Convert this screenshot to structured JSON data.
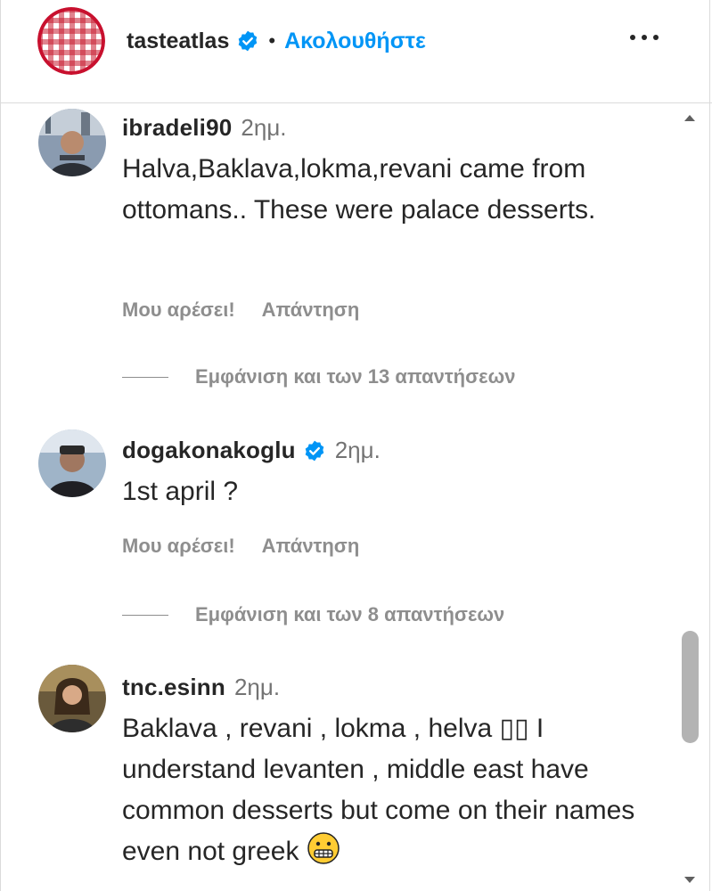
{
  "header": {
    "username": "tasteatlas",
    "separator": "•",
    "follow_label": "Ακολουθήστε"
  },
  "comments": [
    {
      "username": "ibradeli90",
      "time": "2ημ.",
      "verified": false,
      "text": "Halva,Baklava,lokma,revani came from ottomans.. These were palace desserts.",
      "like_label": "Μου αρέσει!",
      "reply_label": "Απάντηση",
      "view_replies": "Εμφάνιση και των 13 απαντήσεων"
    },
    {
      "username": "dogakonakoglu",
      "time": "2ημ.",
      "verified": true,
      "text": "1st april ?",
      "like_label": "Μου αρέσει!",
      "reply_label": "Απάντηση",
      "view_replies": "Εμφάνιση και των 8 απαντήσεων"
    },
    {
      "username": "tnc.esinn",
      "time": "2ημ.",
      "verified": false,
      "text": "Baklava , revani , lokma , helva ▯▯ I understand levanten , middle east have common desserts but come on their names even not greek",
      "emoji": "grimacing-face"
    }
  ],
  "colors": {
    "follow": "#0095f6",
    "verified": "#0095f6",
    "muted": "#8e8e8e",
    "text": "#262626"
  }
}
